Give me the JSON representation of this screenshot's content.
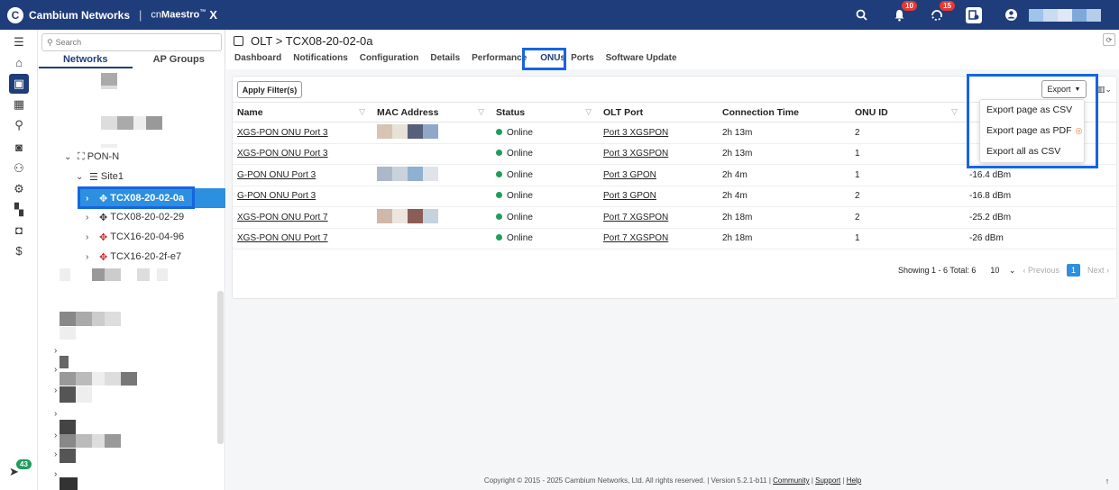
{
  "brand": {
    "company": "Cambium Networks",
    "product_prefix": "cn",
    "product_name": "Maestro",
    "tm": "™",
    "product_suffix": "X"
  },
  "topbar": {
    "alerts_badge": "10",
    "events_badge": "15"
  },
  "rail": {
    "bottom_badge": "43"
  },
  "tree": {
    "search_placeholder": "Search",
    "tabs": [
      "Networks",
      "AP Groups"
    ],
    "nodes": {
      "pon": "PON-N",
      "site": "Site1",
      "olt1": "TCX08-20-02-0a",
      "olt2": "TCX08-20-02-29",
      "olt3": "TCX16-20-04-96",
      "olt4": "TCX16-20-2f-e7"
    }
  },
  "header": {
    "breadcrumb": "OLT > TCX08-20-02-0a",
    "tabs": [
      "Dashboard",
      "Notifications",
      "Configuration",
      "Details",
      "Performance",
      "ONUs",
      "Ports",
      "Software Update"
    ],
    "active_tab": "ONUs"
  },
  "toolbar": {
    "apply_filters": "Apply Filter(s)",
    "export": "Export"
  },
  "export_menu": [
    "Export page as CSV",
    "Export page as PDF",
    "Export all as CSV"
  ],
  "table": {
    "columns": [
      "Name",
      "MAC Address",
      "Status",
      "OLT Port",
      "Connection Time",
      "ONU ID",
      ""
    ],
    "rows": [
      {
        "name": "XGS-PON ONU Port 3",
        "status": "Online",
        "port": "Port 3 XGSPON",
        "time": "2h 13m",
        "onu_id": "2",
        "power": ""
      },
      {
        "name": "XGS-PON ONU Port 3",
        "status": "Online",
        "port": "Port 3 XGSPON",
        "time": "2h 13m",
        "onu_id": "1",
        "power": ""
      },
      {
        "name": "G-PON ONU Port 3",
        "status": "Online",
        "port": "Port 3 GPON",
        "time": "2h 4m",
        "onu_id": "1",
        "power": "-16.4 dBm"
      },
      {
        "name": "G-PON ONU Port 3",
        "status": "Online",
        "port": "Port 3 GPON",
        "time": "2h 4m",
        "onu_id": "2",
        "power": "-16.8 dBm"
      },
      {
        "name": "XGS-PON ONU Port 7",
        "status": "Online",
        "port": "Port 7 XGSPON",
        "time": "2h 18m",
        "onu_id": "2",
        "power": "-25.2 dBm"
      },
      {
        "name": "XGS-PON ONU Port 7",
        "status": "Online",
        "port": "Port 7 XGSPON",
        "time": "2h 18m",
        "onu_id": "1",
        "power": "-26 dBm"
      }
    ]
  },
  "pager": {
    "summary": "Showing 1 - 6 Total: 6",
    "page_size": "10",
    "previous": "‹ Previous",
    "page": "1",
    "next": "Next ›"
  },
  "footer": {
    "copyright": "Copyright © 2015 - 2025 Cambium Networks, Ltd. All rights reserved.",
    "version": "Version 5.2.1-b11",
    "community": "Community",
    "support": "Support",
    "help": "Help"
  },
  "colors": {
    "topbar": "#1f3d7a",
    "accent": "#2d8fe0",
    "online": "#1e9e5a",
    "highlight": "#1565e0"
  }
}
